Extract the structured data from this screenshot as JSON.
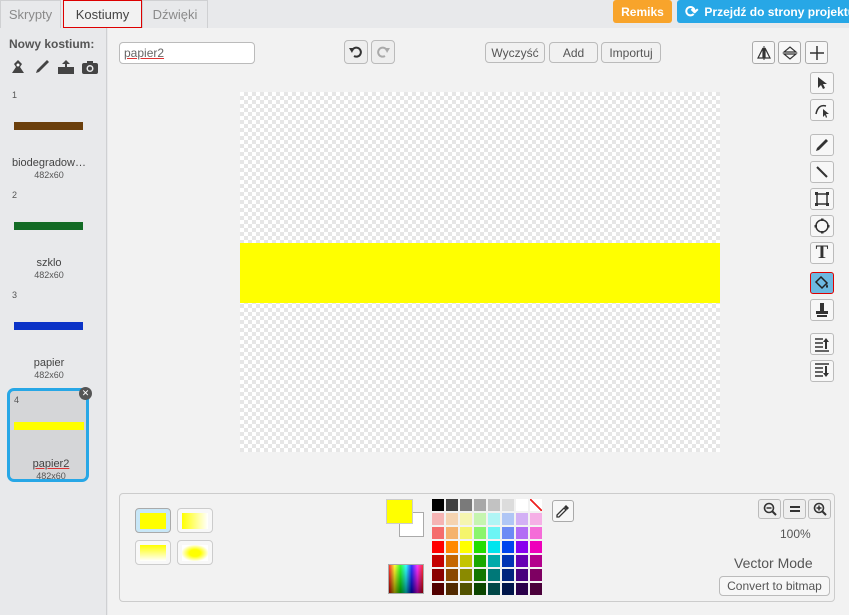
{
  "tabs": [
    {
      "label": "Skrypty",
      "active": false
    },
    {
      "label": "Kostiumy",
      "active": true
    },
    {
      "label": "Dźwięki",
      "active": false
    }
  ],
  "header": {
    "remix_label": "Remiks",
    "project_label": "Przejdź do strony projektu"
  },
  "sidebar": {
    "new_costume_label": "Nowy kostium:",
    "new_icons": [
      "paint-from-library-icon",
      "paint-new-icon",
      "upload-icon",
      "camera-icon"
    ]
  },
  "costumes": [
    {
      "num": "1",
      "name": "biodegradow…",
      "size": "482x60",
      "color": "#6b3f0c",
      "selected": false
    },
    {
      "num": "2",
      "name": "szklo",
      "size": "482x60",
      "color": "#136b25",
      "selected": false
    },
    {
      "num": "3",
      "name": "papier",
      "size": "482x60",
      "color": "#0b33c7",
      "selected": false
    },
    {
      "num": "4",
      "name": "papier2",
      "size": "482x60",
      "color": "#ffff00",
      "selected": true
    }
  ],
  "editor": {
    "costume_name": "papier2",
    "clear_label": "Wyczyść",
    "add_label": "Add",
    "import_label": "Importuj",
    "fill_color": "#ffff00",
    "accent_selected_tool": "#6cb8e0"
  },
  "bottom_panel": {
    "zoom_level": "100%",
    "mode_label": "Vector Mode",
    "convert_label": "Convert to bitmap",
    "palette": [
      "#000000",
      "#404040",
      "#7a7a7a",
      "#a8a8a8",
      "#c2c2c2",
      "#dcdcdc",
      "#ffffff",
      "none",
      "#f5b3b3",
      "#f5d3b0",
      "#f5f5b0",
      "#c6f5b0",
      "#b0f5f5",
      "#b0c6f5",
      "#d3b0f5",
      "#f5b0e6",
      "#f56c6c",
      "#f5b26c",
      "#f5f56c",
      "#8af56c",
      "#6cf5f5",
      "#6c8af5",
      "#b26cf5",
      "#f56cd8",
      "#ff0000",
      "#ff8800",
      "#ffff00",
      "#22dd00",
      "#00e5ee",
      "#0044ee",
      "#8800ee",
      "#ee00bb",
      "#c40000",
      "#c46600",
      "#c4c400",
      "#1aa800",
      "#00aaaa",
      "#0033b3",
      "#6600b3",
      "#b3008c",
      "#8a0000",
      "#8a4800",
      "#8a8a00",
      "#137600",
      "#007878",
      "#00247e",
      "#48007e",
      "#7e0062",
      "#520000",
      "#522a00",
      "#525200",
      "#0b4500",
      "#004747",
      "#00154a",
      "#2a004a",
      "#4a003a"
    ]
  }
}
